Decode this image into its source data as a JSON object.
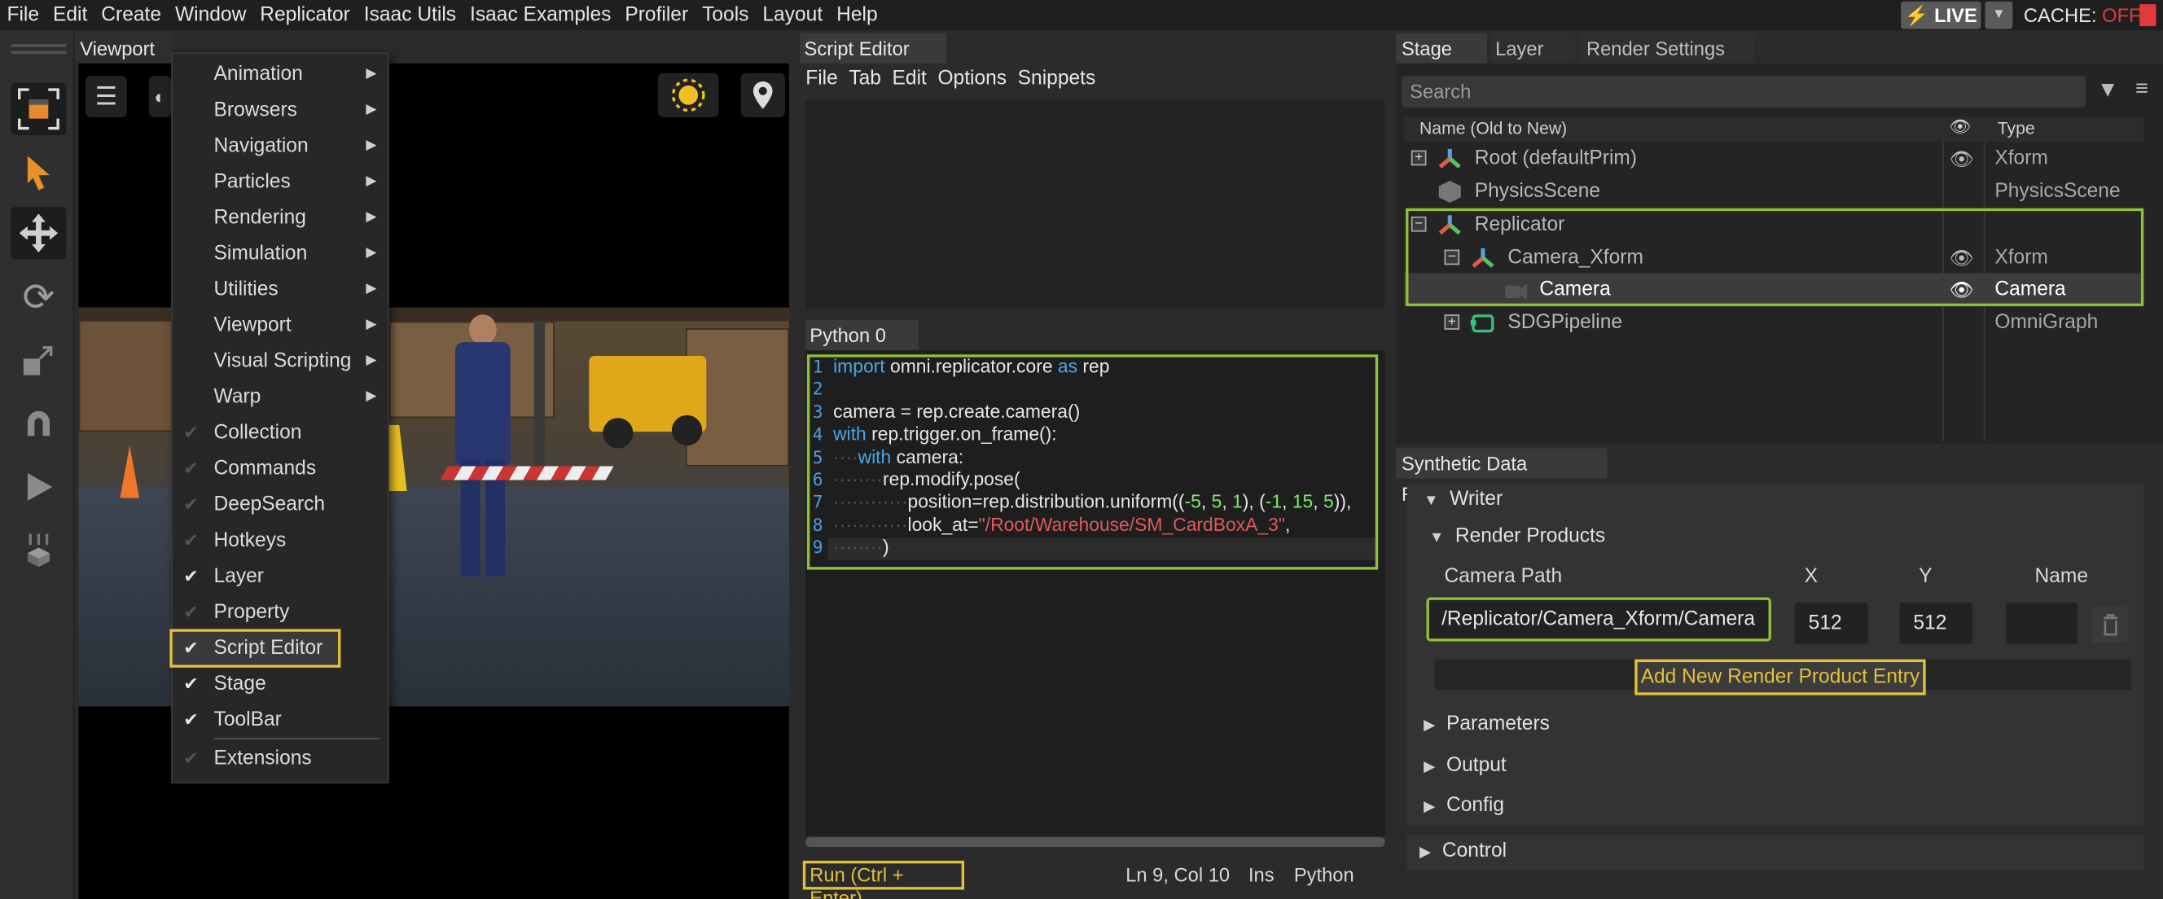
{
  "menubar": {
    "items": [
      "File",
      "Edit",
      "Create",
      "Window",
      "Replicator",
      "Isaac Utils",
      "Isaac Examples",
      "Profiler",
      "Tools",
      "Layout",
      "Help"
    ],
    "live_label": "LIVE",
    "cache_label": "CACHE:",
    "cache_state": "OFF"
  },
  "viewport": {
    "tab": "Viewport"
  },
  "window_menu": {
    "items": [
      {
        "label": "Animation",
        "submenu": true,
        "checked": null
      },
      {
        "label": "Browsers",
        "submenu": true,
        "checked": null
      },
      {
        "label": "Navigation",
        "submenu": true,
        "checked": null
      },
      {
        "label": "Particles",
        "submenu": true,
        "checked": null
      },
      {
        "label": "Rendering",
        "submenu": true,
        "checked": null
      },
      {
        "label": "Simulation",
        "submenu": true,
        "checked": null
      },
      {
        "label": "Utilities",
        "submenu": true,
        "checked": null
      },
      {
        "label": "Viewport",
        "submenu": true,
        "checked": null
      },
      {
        "label": "Visual Scripting",
        "submenu": true,
        "checked": null
      },
      {
        "label": "Warp",
        "submenu": true,
        "checked": null
      },
      {
        "label": "Collection",
        "submenu": false,
        "checked": false
      },
      {
        "label": "Commands",
        "submenu": false,
        "checked": false
      },
      {
        "label": "DeepSearch",
        "submenu": false,
        "checked": false
      },
      {
        "label": "Hotkeys",
        "submenu": false,
        "checked": false
      },
      {
        "label": "Layer",
        "submenu": false,
        "checked": true
      },
      {
        "label": "Property",
        "submenu": false,
        "checked": false
      },
      {
        "label": "Script Editor",
        "submenu": false,
        "checked": true
      },
      {
        "label": "Stage",
        "submenu": false,
        "checked": true
      },
      {
        "label": "ToolBar",
        "submenu": false,
        "checked": true
      },
      {
        "label": "Extensions",
        "submenu": false,
        "checked": false
      }
    ]
  },
  "script_editor": {
    "tab": "Script Editor",
    "menu": [
      "File",
      "Tab",
      "Edit",
      "Options",
      "Snippets"
    ],
    "python_tab": "Python 0",
    "line_numbers": [
      "1",
      "2",
      "3",
      "4",
      "5",
      "6",
      "7",
      "8",
      "9"
    ],
    "run_label": "Run (Ctrl + Enter)",
    "status": {
      "position": "Ln 9, Col 10",
      "mode": "Ins",
      "language": "Python"
    }
  },
  "stage": {
    "tabs": [
      "Stage",
      "Layer",
      "Render Settings"
    ],
    "search_placeholder": "Search",
    "col_name": "Name (Old to New)",
    "col_type": "Type",
    "rows": [
      {
        "name": "Root (defaultPrim)",
        "type": "Xform"
      },
      {
        "name": "PhysicsScene",
        "type": "PhysicsScene"
      },
      {
        "name": "Replicator",
        "type": ""
      },
      {
        "name": "Camera_Xform",
        "type": "Xform"
      },
      {
        "name": "Camera",
        "type": "Camera"
      },
      {
        "name": "SDGPipeline",
        "type": "OmniGraph"
      }
    ]
  },
  "sdr": {
    "tab": "Synthetic Data Recorder",
    "writer": "Writer",
    "render_products": "Render Products",
    "col_camera_path": "Camera Path",
    "col_x": "X",
    "col_y": "Y",
    "col_name": "Name",
    "camera_path": "/Replicator/Camera_Xform/Camera",
    "x": "512",
    "y": "512",
    "name": "",
    "add_button": "Add New Render Product Entry",
    "parameters": "Parameters",
    "output": "Output",
    "config": "Config",
    "control": "Control"
  }
}
